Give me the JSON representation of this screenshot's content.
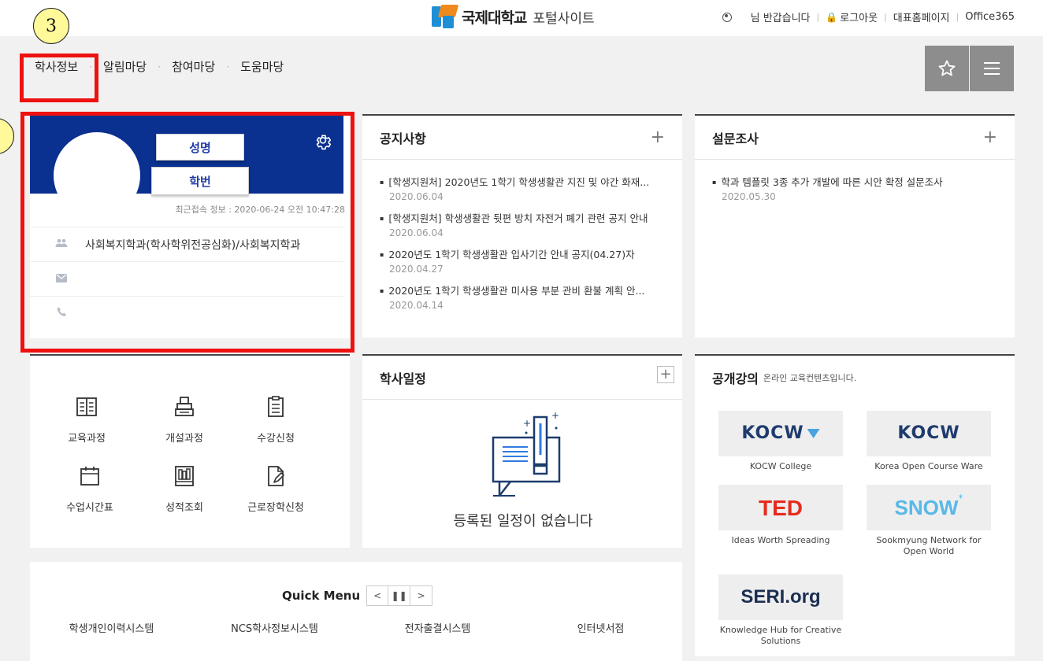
{
  "header": {
    "logo_name": "국제대학교",
    "logo_sub": "포털사이트",
    "greeting": "님 반갑습니다",
    "logout": "로그아웃",
    "homepage": "대표홈페이지",
    "office": "Office365"
  },
  "nav": {
    "items": [
      "학사정보",
      "알림마당",
      "참여마당",
      "도움마당"
    ],
    "favorite_icon": "star-icon",
    "menu_icon": "hamburger-icon"
  },
  "annotations": {
    "badge_3": "3",
    "badge_left": "",
    "box_color": "#ee1111",
    "badge_color": "#fff99a"
  },
  "profile": {
    "name_label": "성명",
    "id_label": "학번",
    "last_login": "최근접속 정보 : 2020-06-24 오전 10:47:28",
    "department": "사회복지학과(학사학위전공심화)/사회복지학과",
    "email": "",
    "phone": "",
    "header_color": "#0a3090"
  },
  "notices": {
    "title": "공지사항",
    "items": [
      {
        "title": "[학생지원처] 2020년도 1학기 학생생활관 지진 및 야간 화재...",
        "date": "2020.06.04"
      },
      {
        "title": "[학생지원처] 학생생활관 뒷편 방치 자전거 폐기 관련 공지 안내",
        "date": "2020.06.04"
      },
      {
        "title": "2020년도 1학기 학생생활관 입사기간 안내 공지(04.27)자",
        "date": "2020.04.27"
      },
      {
        "title": "2020년도 1학기 학생생활관 미사용 부분 관비 환불 계획 안...",
        "date": "2020.04.14"
      }
    ]
  },
  "survey": {
    "title": "설문조사",
    "items": [
      {
        "title": "학과 템플릿 3종 추가 개발에 따른 시안 확정 설문조사",
        "date": "2020.05.30"
      }
    ]
  },
  "menu": {
    "items": [
      {
        "label": "교육과정",
        "icon": "book-icon"
      },
      {
        "label": "개설과정",
        "icon": "books-stack-icon"
      },
      {
        "label": "수강신청",
        "icon": "clipboard-icon"
      },
      {
        "label": "수업시간표",
        "icon": "calendar-icon"
      },
      {
        "label": "성적조회",
        "icon": "bookshelf-icon"
      },
      {
        "label": "근로장학신청",
        "icon": "document-edit-icon"
      }
    ]
  },
  "schedule": {
    "title": "학사일정",
    "empty": "등록된 일정이 없습니다"
  },
  "lectures": {
    "title": "공개강의",
    "subtitle": "온라인 교육컨텐츠입니다.",
    "items": [
      {
        "logo": "KOCW",
        "caption": "KOCW College"
      },
      {
        "logo": "KOCW",
        "caption": "Korea Open Course Ware"
      },
      {
        "logo": "TED",
        "caption": "Ideas Worth Spreading"
      },
      {
        "logo": "SNOW",
        "caption": "Sookmyung Network for Open World"
      },
      {
        "logo": "SERI.org",
        "caption": "Knowledge Hub for Creative Solutions"
      }
    ]
  },
  "quick_menu": {
    "title": "Quick Menu",
    "links": [
      "학생개인이력시스템",
      "NCS학사정보시스템",
      "전자출결시스템",
      "인터넷서점"
    ]
  }
}
